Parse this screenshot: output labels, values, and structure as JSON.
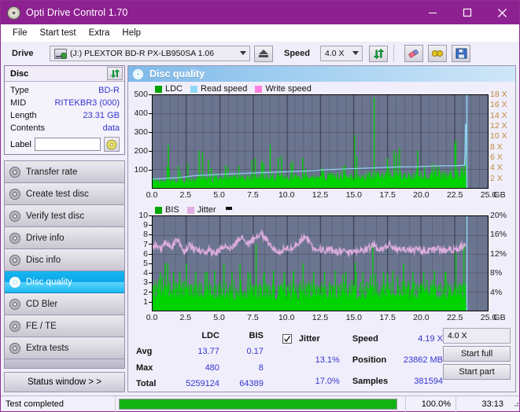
{
  "window": {
    "title": "Opti Drive Control 1.70",
    "icon": "disc-icon",
    "minimize": "minimize-icon",
    "maximize": "maximize-icon",
    "close": "close-icon"
  },
  "menu": {
    "items": [
      "File",
      "Start test",
      "Extra",
      "Help"
    ]
  },
  "toolbar": {
    "drive_label": "Drive",
    "drive_value": "(J:)   PLEXTOR BD-R  PX-LB950SA 1.06",
    "eject_icon": "eject-icon",
    "speed_label": "Speed",
    "speed_value": "4.0 X",
    "refresh_icon": "refresh-icon",
    "eraser_icon": "eraser-icon",
    "settings_icon": "glasses-icon",
    "save_icon": "floppy-save-icon"
  },
  "disc": {
    "header": "Disc",
    "refresh_icon": "refresh-icon",
    "rows": [
      {
        "key": "Type",
        "value": "BD-R"
      },
      {
        "key": "MID",
        "value": "RITEKBR3 (000)"
      },
      {
        "key": "Length",
        "value": "23.31 GB"
      },
      {
        "key": "Contents",
        "value": "data"
      }
    ],
    "label_key": "Label",
    "label_value": "",
    "label_placeholder": "",
    "disc_button_icon": "cd-icon"
  },
  "nav": {
    "items": [
      {
        "label": "Transfer rate",
        "icon": "disc-icon",
        "active": false
      },
      {
        "label": "Create test disc",
        "icon": "disc-icon",
        "active": false
      },
      {
        "label": "Verify test disc",
        "icon": "disc-icon",
        "active": false
      },
      {
        "label": "Drive info",
        "icon": "disc-icon",
        "active": false
      },
      {
        "label": "Disc info",
        "icon": "disc-icon",
        "active": false
      },
      {
        "label": "Disc quality",
        "icon": "disc-icon",
        "active": true
      },
      {
        "label": "CD Bler",
        "icon": "disc-icon",
        "active": false
      },
      {
        "label": "FE / TE",
        "icon": "disc-icon",
        "active": false
      },
      {
        "label": "Extra tests",
        "icon": "disc-icon",
        "active": false
      }
    ],
    "status_window": "Status window > >"
  },
  "panel": {
    "title": "Disc quality",
    "icon": "disc-icon"
  },
  "stats": {
    "col_ldc": "LDC",
    "col_bis": "BIS",
    "jitter_label": "Jitter",
    "jitter_checked": true,
    "rows": [
      {
        "label": "Avg",
        "ldc": "13.77",
        "bis": "0.17",
        "jitter": "13.1%"
      },
      {
        "label": "Max",
        "ldc": "480",
        "bis": "8",
        "jitter": "17.0%"
      },
      {
        "label": "Total",
        "ldc": "5259124",
        "bis": "64389",
        "jitter": ""
      }
    ],
    "speed_label": "Speed",
    "speed_value": "4.19 X",
    "position_label": "Position",
    "position_value": "23862 MB",
    "samples_label": "Samples",
    "samples_value": "381594",
    "speed_select": "4.0 X",
    "start_full": "Start full",
    "start_part": "Start part"
  },
  "statusbar": {
    "message": "Test completed",
    "percent_text": "100.0%",
    "percent_value": 100,
    "elapsed": "33:13"
  },
  "colors": {
    "title_bar": "#8e2191",
    "ldc_green": "#00d400",
    "read_speed": "#8fd8f7",
    "write_speed": "#ff7fe0",
    "bis_green": "#00d400",
    "jitter_pink": "#e0aee0",
    "plot_bg": "#6b7590",
    "value_blue": "#3535cf",
    "right_axis_orange": "#c08a3e",
    "progress_green": "#12b312"
  },
  "chart_data": [
    {
      "type": "area",
      "id": "ldc-chart",
      "title": "",
      "legend": [
        {
          "name": "LDC",
          "color": "#00a400"
        },
        {
          "name": "Read speed",
          "color": "#8fd8f7"
        },
        {
          "name": "Write speed",
          "color": "#ff7fe0"
        }
      ],
      "legend_position": "top-left",
      "xlabel": "GB",
      "xlim": [
        0,
        25.0
      ],
      "xticks": [
        0.0,
        2.5,
        5.0,
        7.5,
        10.0,
        12.5,
        15.0,
        17.5,
        20.0,
        22.5,
        25.0
      ],
      "xticklabels": [
        "0.0",
        "2.5",
        "5.0",
        "7.5",
        "10.0",
        "12.5",
        "15.0",
        "17.5",
        "20.0",
        "22.5",
        "25.0"
      ],
      "ylabel": "LDC",
      "ylim": [
        0,
        500
      ],
      "yticks": [
        100,
        200,
        300,
        400,
        500
      ],
      "yticklabels": [
        "100",
        "200",
        "300",
        "400",
        "500"
      ],
      "y2label": "Speed",
      "y2lim": [
        0,
        18
      ],
      "y2ticks": [
        2,
        4,
        6,
        8,
        10,
        12,
        14,
        16,
        18
      ],
      "y2ticklabels": [
        "2 X",
        "4 X",
        "6 X",
        "8 X",
        "10 X",
        "12 X",
        "14 X",
        "16 X",
        "18 X"
      ],
      "grid": true,
      "data_end_gb": 23.4,
      "series": [
        {
          "name": "LDC",
          "type": "area",
          "color": "#00d400",
          "baseline_x": [
            0.0,
            1.0,
            2.0,
            3.0,
            4.0,
            5.0,
            6.0,
            7.0,
            8.0,
            9.0,
            10.0,
            11.0,
            12.0,
            13.0,
            14.0,
            15.0,
            16.0,
            17.0,
            18.0,
            19.0,
            20.0,
            21.0,
            22.0,
            23.0,
            23.4
          ],
          "baseline_y": [
            45,
            40,
            42,
            48,
            50,
            52,
            55,
            55,
            58,
            60,
            60,
            62,
            62,
            64,
            65,
            66,
            68,
            68,
            70,
            70,
            72,
            74,
            76,
            92,
            100
          ],
          "spikes": [
            {
              "x": 1.15,
              "y": 232
            },
            {
              "x": 2.6,
              "y": 130
            },
            {
              "x": 3.45,
              "y": 200
            },
            {
              "x": 3.7,
              "y": 190
            },
            {
              "x": 4.15,
              "y": 150
            },
            {
              "x": 4.35,
              "y": 108
            },
            {
              "x": 5.6,
              "y": 112
            },
            {
              "x": 6.4,
              "y": 118
            },
            {
              "x": 7.4,
              "y": 150
            },
            {
              "x": 8.1,
              "y": 128
            },
            {
              "x": 8.75,
              "y": 233
            },
            {
              "x": 9.35,
              "y": 165
            },
            {
              "x": 9.6,
              "y": 172
            },
            {
              "x": 10.3,
              "y": 130
            },
            {
              "x": 11.4,
              "y": 104
            },
            {
              "x": 12.6,
              "y": 110
            },
            {
              "x": 14.2,
              "y": 112
            },
            {
              "x": 15.05,
              "y": 285
            },
            {
              "x": 16.5,
              "y": 490
            },
            {
              "x": 17.6,
              "y": 120
            },
            {
              "x": 18.4,
              "y": 215
            },
            {
              "x": 19.7,
              "y": 112
            },
            {
              "x": 21.1,
              "y": 120
            },
            {
              "x": 22.6,
              "y": 258
            },
            {
              "x": 23.3,
              "y": 265
            }
          ]
        },
        {
          "name": "Read speed",
          "type": "line",
          "color": "#8fd8f7",
          "axis": "y2",
          "x": [
            0.0,
            0.6,
            1.2,
            2.0,
            2.6,
            3.2,
            4.0,
            4.8,
            5.6,
            6.6,
            7.6,
            8.6,
            9.6,
            10.6,
            11.6,
            12.6,
            13.6,
            14.6,
            15.6,
            16.6,
            17.6,
            18.6,
            19.6,
            20.6,
            21.6,
            22.4,
            23.3,
            23.4
          ],
          "y": [
            1.7,
            1.8,
            1.9,
            2.0,
            2.2,
            2.4,
            2.5,
            2.6,
            2.7,
            2.8,
            2.9,
            3.0,
            3.1,
            3.2,
            3.3,
            3.5,
            3.6,
            3.7,
            3.8,
            3.9,
            4.0,
            4.1,
            4.1,
            4.2,
            4.3,
            4.3,
            4.4,
            18.0
          ]
        },
        {
          "name": "Write speed",
          "type": "line",
          "color": "#ff7fe0",
          "x": [],
          "y": []
        }
      ]
    },
    {
      "type": "area",
      "id": "bis-chart",
      "title": "",
      "legend": [
        {
          "name": "BIS",
          "color": "#00a400"
        },
        {
          "name": "Jitter",
          "color": "#e0aee0"
        }
      ],
      "legend_position": "top-left",
      "xlabel": "GB",
      "xlim": [
        0,
        25.0
      ],
      "xticks": [
        0.0,
        2.5,
        5.0,
        7.5,
        10.0,
        12.5,
        15.0,
        17.5,
        20.0,
        22.5,
        25.0
      ],
      "xticklabels": [
        "0.0",
        "2.5",
        "5.0",
        "7.5",
        "10.0",
        "12.5",
        "15.0",
        "17.5",
        "20.0",
        "22.5",
        "25.0"
      ],
      "ylabel": "BIS",
      "ylim": [
        0,
        10
      ],
      "yticks": [
        1,
        2,
        3,
        4,
        5,
        6,
        7,
        8,
        9,
        10
      ],
      "yticklabels": [
        "1",
        "2",
        "3",
        "4",
        "5",
        "6",
        "7",
        "8",
        "9",
        "10"
      ],
      "y2label": "Jitter",
      "y2lim": [
        0,
        20
      ],
      "y2ticks": [
        4,
        8,
        12,
        16,
        20
      ],
      "y2ticklabels": [
        "4%",
        "8%",
        "12%",
        "16%",
        "20%"
      ],
      "grid": true,
      "data_end_gb": 23.4,
      "series": [
        {
          "name": "BIS",
          "type": "area",
          "color": "#00d400",
          "baseline_level": 2.0,
          "baseline_x": [
            0.0,
            2.0,
            4.0,
            6.0,
            8.0,
            10.0,
            12.0,
            14.0,
            16.0,
            18.0,
            20.0,
            22.0,
            23.4
          ],
          "baseline_y": [
            2.0,
            2.0,
            2.0,
            2.0,
            2.0,
            2.0,
            2.0,
            2.0,
            2.0,
            2.0,
            2.0,
            2.0,
            2.2
          ],
          "spike_band": [
            2.5,
            3.2
          ],
          "spikes": [
            {
              "x": 0.55,
              "y": 4.1
            },
            {
              "x": 0.9,
              "y": 5.0
            },
            {
              "x": 1.1,
              "y": 5.0
            },
            {
              "x": 1.55,
              "y": 4.1
            },
            {
              "x": 2.0,
              "y": 4.1
            },
            {
              "x": 2.5,
              "y": 5.0
            },
            {
              "x": 3.2,
              "y": 4.1
            },
            {
              "x": 3.9,
              "y": 4.1
            },
            {
              "x": 4.6,
              "y": 4.2
            },
            {
              "x": 5.3,
              "y": 5.0
            },
            {
              "x": 5.9,
              "y": 4.1
            },
            {
              "x": 6.5,
              "y": 5.0
            },
            {
              "x": 7.1,
              "y": 4.1
            },
            {
              "x": 7.7,
              "y": 7.0
            },
            {
              "x": 8.3,
              "y": 4.1
            },
            {
              "x": 9.0,
              "y": 4.2
            },
            {
              "x": 9.8,
              "y": 4.1
            },
            {
              "x": 10.5,
              "y": 4.2
            },
            {
              "x": 11.2,
              "y": 5.0
            },
            {
              "x": 12.0,
              "y": 4.1
            },
            {
              "x": 12.8,
              "y": 4.1
            },
            {
              "x": 13.6,
              "y": 4.2
            },
            {
              "x": 14.4,
              "y": 4.1
            },
            {
              "x": 15.1,
              "y": 5.1
            },
            {
              "x": 16.4,
              "y": 7.1
            },
            {
              "x": 17.2,
              "y": 4.1
            },
            {
              "x": 17.9,
              "y": 4.2
            },
            {
              "x": 18.7,
              "y": 5.0
            },
            {
              "x": 19.4,
              "y": 4.1
            },
            {
              "x": 20.2,
              "y": 4.1
            },
            {
              "x": 21.0,
              "y": 4.2
            },
            {
              "x": 21.8,
              "y": 4.1
            },
            {
              "x": 22.6,
              "y": 6.1
            },
            {
              "x": 23.2,
              "y": 7.0
            }
          ]
        },
        {
          "name": "Jitter",
          "type": "line",
          "color": "#e0aee0",
          "axis": "y2",
          "x": [
            0.0,
            0.3,
            0.6,
            0.9,
            1.2,
            1.5,
            1.8,
            2.1,
            2.4,
            2.7,
            3.0,
            3.3,
            3.6,
            3.9,
            4.2,
            4.5,
            4.8,
            5.1,
            5.4,
            5.7,
            6.0,
            6.3,
            6.6,
            6.9,
            7.2,
            7.5,
            7.8,
            8.1,
            8.4,
            8.7,
            9.0,
            9.3,
            9.6,
            9.9,
            10.2,
            10.5,
            10.8,
            11.1,
            11.4,
            11.7,
            12.0,
            12.3,
            12.6,
            12.9,
            13.2,
            13.5,
            13.8,
            14.1,
            14.4,
            14.7,
            15.0,
            15.3,
            15.6,
            15.9,
            16.2,
            16.5,
            16.8,
            17.1,
            17.4,
            17.7,
            18.0,
            18.3,
            18.6,
            18.9,
            19.2,
            19.5,
            19.8,
            20.1,
            20.4,
            20.7,
            21.0,
            21.3,
            21.6,
            21.9,
            22.2,
            22.5,
            22.8,
            23.1,
            23.3
          ],
          "y": [
            13.4,
            14.0,
            13.2,
            14.4,
            14.2,
            13.6,
            15.2,
            14.2,
            12.4,
            13.8,
            13.4,
            13.0,
            12.6,
            12.4,
            12.8,
            12.4,
            12.6,
            13.0,
            13.4,
            13.2,
            13.6,
            14.6,
            15.8,
            14.6,
            14.4,
            15.2,
            15.6,
            16.2,
            15.4,
            14.2,
            13.2,
            12.4,
            12.8,
            13.2,
            13.0,
            13.4,
            14.0,
            15.0,
            16.0,
            14.8,
            13.2,
            12.8,
            13.0,
            12.6,
            12.8,
            12.6,
            12.4,
            12.8,
            12.6,
            12.4,
            12.8,
            12.6,
            13.0,
            12.8,
            13.4,
            14.0,
            12.8,
            13.0,
            13.4,
            14.2,
            13.0,
            12.8,
            13.2,
            12.8,
            13.0,
            12.8,
            13.2,
            12.6,
            12.8,
            13.0,
            12.8,
            13.2,
            12.6,
            12.8,
            13.0,
            12.8,
            13.2,
            13.6,
            14.0
          ]
        }
      ]
    }
  ]
}
